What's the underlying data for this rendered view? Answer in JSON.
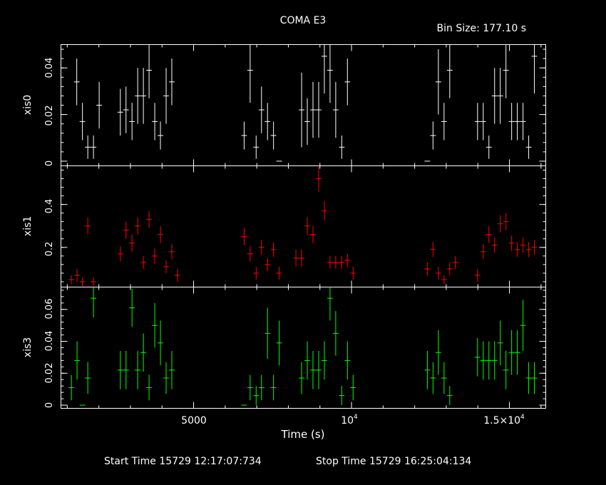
{
  "title": "COMA E3",
  "bin_label": "Bin Size: 177.10 s",
  "footer": {
    "start": "Start Time 15729 12:17:07:734",
    "stop": "Stop Time 15729 16:25:04:134"
  },
  "chart_data": [
    {
      "type": "scatter",
      "name": "xis0",
      "ylabel": "xis0",
      "color": "#ffffff",
      "xlim": [
        800,
        16150
      ],
      "ylim": [
        -0.002,
        0.05
      ],
      "yticks": [
        0,
        0.02,
        0.04
      ],
      "yticklabels": [
        "0",
        "0.02",
        "0.04"
      ],
      "xticks": [
        5000,
        10000,
        15000
      ],
      "x": [
        1300,
        1480,
        1650,
        1830,
        2010,
        2680,
        2860,
        3050,
        3230,
        3410,
        3590,
        3770,
        3950,
        4130,
        4310,
        6600,
        6790,
        6980,
        7150,
        7340,
        7530,
        7710,
        8420,
        8600,
        8780,
        8960,
        9140,
        9320,
        9500,
        9690,
        9870,
        12400,
        12580,
        12750,
        12930,
        13110,
        13990,
        14170,
        14350,
        14530,
        14710,
        14890,
        15070,
        15250,
        15430,
        15610,
        15790
      ],
      "y": [
        0.034,
        0.017,
        0.006,
        0.006,
        0.024,
        0.021,
        0.022,
        0.017,
        0.028,
        0.028,
        0.039,
        0.017,
        0.011,
        0.028,
        0.034,
        0.011,
        0.039,
        0.006,
        0.022,
        0.017,
        0.011,
        0.0,
        0.022,
        0.017,
        0.022,
        0.022,
        0.045,
        0.039,
        0.022,
        0.006,
        0.034,
        0.0,
        0.011,
        0.034,
        0.017,
        0.039,
        0.017,
        0.017,
        0.006,
        0.028,
        0.028,
        0.039,
        0.017,
        0.017,
        0.017,
        0.006,
        0.045
      ],
      "yerr": [
        0.01,
        0.008,
        0.005,
        0.005,
        0.01,
        0.01,
        0.01,
        0.008,
        0.012,
        0.012,
        0.012,
        0.008,
        0.006,
        0.012,
        0.01,
        0.006,
        0.014,
        0.005,
        0.01,
        0.008,
        0.006,
        0.0,
        0.016,
        0.01,
        0.012,
        0.012,
        0.016,
        0.014,
        0.012,
        0.005,
        0.01,
        0.0,
        0.006,
        0.014,
        0.008,
        0.012,
        0.008,
        0.008,
        0.005,
        0.012,
        0.012,
        0.012,
        0.008,
        0.008,
        0.008,
        0.005,
        0.016
      ]
    },
    {
      "type": "scatter",
      "name": "xis1",
      "ylabel": "xis1",
      "color": "#ff0000",
      "xlim": [
        800,
        16150
      ],
      "ylim": [
        0.015,
        0.58
      ],
      "yticks": [
        0.2,
        0.4
      ],
      "yticklabels": [
        "0.2",
        "0.4"
      ],
      "xticks": [
        5000,
        10000,
        15000
      ],
      "x": [
        1130,
        1310,
        1480,
        1650,
        1830,
        2680,
        2860,
        3050,
        3230,
        3410,
        3590,
        3770,
        3950,
        4130,
        4310,
        4490,
        6600,
        6790,
        6980,
        7150,
        7340,
        7530,
        7710,
        8240,
        8420,
        8600,
        8780,
        8960,
        9140,
        9320,
        9500,
        9690,
        9870,
        10050,
        12400,
        12580,
        12750,
        12930,
        13110,
        13290,
        13990,
        14170,
        14350,
        14530,
        14710,
        14890,
        15070,
        15250,
        15430,
        15610,
        15790
      ],
      "y": [
        0.05,
        0.07,
        0.04,
        0.3,
        0.04,
        0.17,
        0.28,
        0.22,
        0.3,
        0.13,
        0.33,
        0.16,
        0.26,
        0.11,
        0.18,
        0.07,
        0.25,
        0.17,
        0.08,
        0.2,
        0.12,
        0.19,
        0.08,
        0.15,
        0.15,
        0.3,
        0.26,
        0.52,
        0.37,
        0.13,
        0.13,
        0.13,
        0.14,
        0.08,
        0.1,
        0.19,
        0.08,
        0.05,
        0.1,
        0.13,
        0.07,
        0.18,
        0.26,
        0.21,
        0.31,
        0.32,
        0.22,
        0.19,
        0.21,
        0.19,
        0.2
      ],
      "yerr": [
        0.02,
        0.03,
        0.02,
        0.04,
        0.02,
        0.035,
        0.04,
        0.04,
        0.04,
        0.03,
        0.04,
        0.035,
        0.04,
        0.03,
        0.035,
        0.03,
        0.04,
        0.035,
        0.03,
        0.035,
        0.03,
        0.035,
        0.03,
        0.04,
        0.04,
        0.04,
        0.04,
        0.06,
        0.045,
        0.03,
        0.03,
        0.03,
        0.03,
        0.03,
        0.03,
        0.035,
        0.03,
        0.02,
        0.03,
        0.03,
        0.03,
        0.035,
        0.04,
        0.035,
        0.04,
        0.04,
        0.035,
        0.035,
        0.035,
        0.035,
        0.035
      ]
    },
    {
      "type": "scatter",
      "name": "xis3",
      "ylabel": "xis3",
      "color": "#00ff00",
      "xlim": [
        800,
        16150
      ],
      "ylim": [
        -0.002,
        0.074
      ],
      "yticks": [
        0,
        0.02,
        0.04,
        0.06
      ],
      "yticklabels": [
        "0",
        "0.02",
        "0.04",
        "0.06"
      ],
      "xticks": [
        5000,
        10000,
        15000
      ],
      "x": [
        1130,
        1310,
        1480,
        1650,
        1830,
        2680,
        2860,
        3050,
        3230,
        3410,
        3590,
        3770,
        3950,
        4130,
        4310,
        6600,
        6790,
        6980,
        7150,
        7340,
        7530,
        7710,
        8420,
        8600,
        8780,
        8960,
        9140,
        9320,
        9500,
        9690,
        9870,
        10050,
        12400,
        12580,
        12750,
        12930,
        13110,
        13990,
        14170,
        14350,
        14530,
        14710,
        14890,
        15070,
        15250,
        15430,
        15610,
        15790
      ],
      "y": [
        0.011,
        0.028,
        0.0,
        0.017,
        0.067,
        0.022,
        0.022,
        0.061,
        0.022,
        0.033,
        0.011,
        0.05,
        0.039,
        0.017,
        0.022,
        0.0,
        0.011,
        0.006,
        0.011,
        0.045,
        0.011,
        0.039,
        0.017,
        0.028,
        0.022,
        0.022,
        0.028,
        0.067,
        0.045,
        0.006,
        0.028,
        0.011,
        0.022,
        0.017,
        0.033,
        0.017,
        0.006,
        0.03,
        0.028,
        0.028,
        0.028,
        0.039,
        0.022,
        0.033,
        0.033,
        0.05,
        0.017,
        0.017
      ],
      "yerr": [
        0.008,
        0.012,
        0.0,
        0.01,
        0.012,
        0.012,
        0.012,
        0.012,
        0.012,
        0.012,
        0.008,
        0.014,
        0.014,
        0.01,
        0.012,
        0.0,
        0.008,
        0.006,
        0.008,
        0.016,
        0.008,
        0.014,
        0.01,
        0.012,
        0.012,
        0.012,
        0.012,
        0.014,
        0.014,
        0.006,
        0.012,
        0.008,
        0.012,
        0.01,
        0.014,
        0.01,
        0.006,
        0.012,
        0.012,
        0.012,
        0.012,
        0.014,
        0.012,
        0.014,
        0.014,
        0.016,
        0.01,
        0.01
      ]
    }
  ],
  "xaxis": {
    "label": "Time (s)",
    "tick_labels": [
      "5000",
      "10",
      "4",
      "1.5×10",
      "4"
    ]
  }
}
